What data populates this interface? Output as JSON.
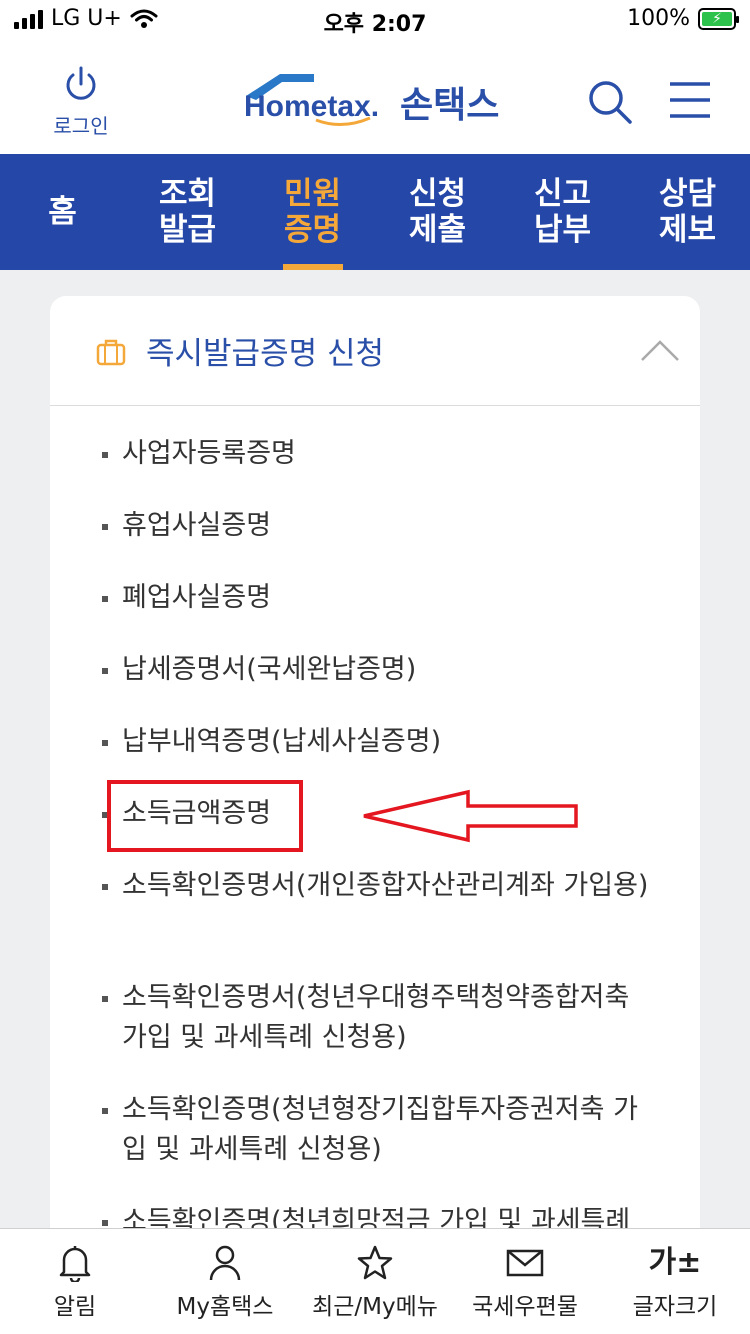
{
  "status_bar": {
    "carrier": "LG U+",
    "time": "오후 2:07",
    "battery": "100%"
  },
  "header": {
    "login_label": "로그인",
    "logo_text": "Hometax.",
    "brand_label": "손택스"
  },
  "nav": {
    "items": [
      {
        "label": "홈"
      },
      {
        "label": "조회\n발급"
      },
      {
        "label": "민원\n증명"
      },
      {
        "label": "신청\n제출"
      },
      {
        "label": "신고\n납부"
      },
      {
        "label": "상담\n제보"
      }
    ],
    "active_index": 2
  },
  "card": {
    "title": "즉시발급증명 신청",
    "items": [
      "사업자등록증명",
      "휴업사실증명",
      "폐업사실증명",
      "납세증명서(국세완납증명)",
      "납부내역증명(납세사실증명)",
      "소득금액증명",
      "소득확인증명서(개인종합자산관리계좌 가입용)",
      "소득확인증명서(청년우대형주택청약종합저축 가입 및 과세특례 신청용)",
      "소득확인증명(청년형장기집합투자증권저축 가입 및 과세특례 신청용)",
      "소득확인증명(청년희망적금 가입 및 과세특례"
    ]
  },
  "tabbar": {
    "items": [
      {
        "label": "알림",
        "icon": "bell-icon"
      },
      {
        "label": "My홈택스",
        "icon": "person-icon"
      },
      {
        "label": "최근/My메뉴",
        "icon": "star-icon"
      },
      {
        "label": "국세우편물",
        "icon": "mail-icon"
      },
      {
        "label": "글자크기",
        "icon": "font-size-icon",
        "glyph": "가±"
      }
    ]
  },
  "colors": {
    "primary": "#2547a8",
    "accent": "#f4a83a",
    "annotation": "#e4161f"
  }
}
